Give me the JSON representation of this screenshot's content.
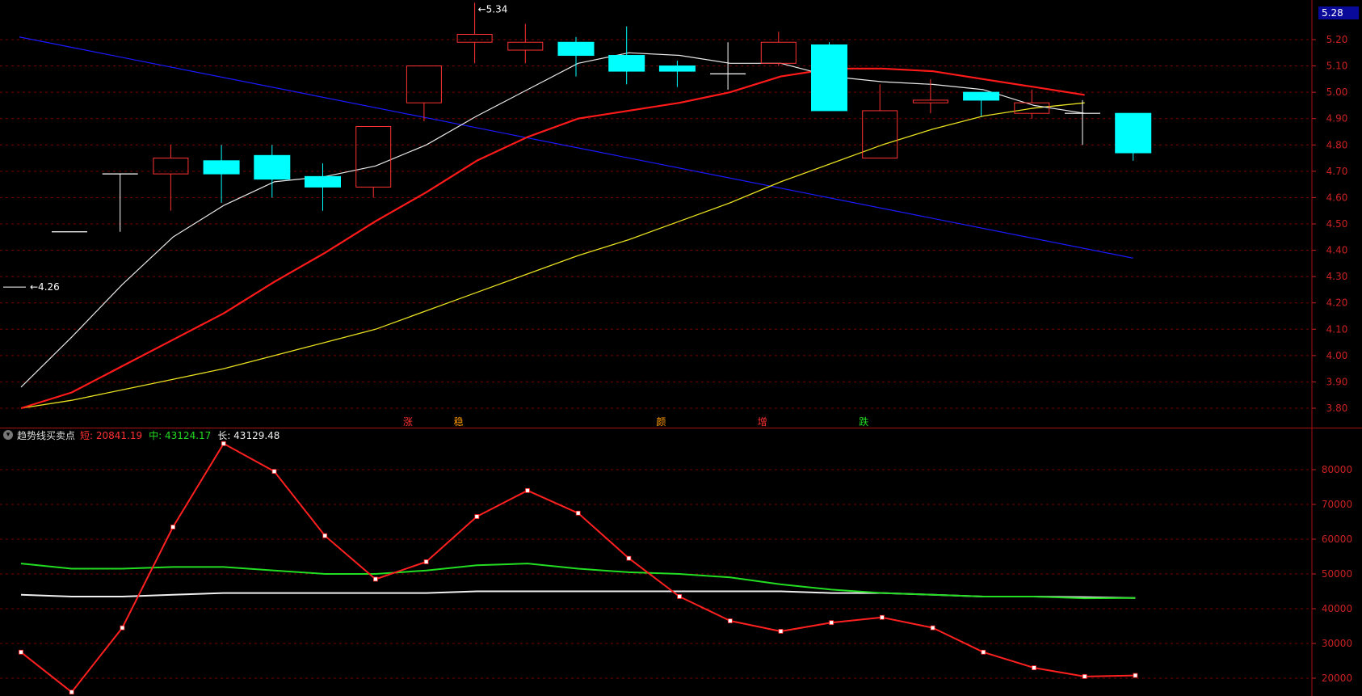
{
  "indicator": {
    "name": "趋势线买卖点",
    "short_label": "短",
    "mid_label": "中",
    "long_label": "长",
    "short_value": "20841.19",
    "mid_value": "43124.17",
    "long_value": "43129.48",
    "collapse_icon": "chevron-down-icon"
  },
  "current_price": "5.28",
  "colors": {
    "up": "#ff3333",
    "down": "#00ffff",
    "ma_white": "#e8e8e8",
    "ma_red": "#ff1a1a",
    "ma_yellow": "#e8e020",
    "trend_blue": "#1a1aff",
    "grid": "#7a0000",
    "axis_text": "#cc2222",
    "short_line": "#ff2020",
    "mid_line": "#22dd22",
    "long_line": "#f0f0f0"
  },
  "chart_data": [
    {
      "type": "candlestick",
      "ylim": [
        3.73,
        5.33
      ],
      "y_ticks": [
        "5.20",
        "5.10",
        "5.00",
        "4.90",
        "4.80",
        "4.70",
        "4.60",
        "4.50",
        "4.40",
        "4.30",
        "4.20",
        "4.10",
        "4.00",
        "3.90",
        "3.80"
      ],
      "candles": [
        {
          "open": 4.47,
          "close": 4.47,
          "high": 4.47,
          "low": 4.47
        },
        {
          "open": 4.69,
          "close": 4.69,
          "high": 4.69,
          "low": 4.47
        },
        {
          "open": 4.69,
          "close": 4.75,
          "high": 4.8,
          "low": 4.55
        },
        {
          "open": 4.74,
          "close": 4.69,
          "high": 4.8,
          "low": 4.58
        },
        {
          "open": 4.76,
          "close": 4.67,
          "high": 4.8,
          "low": 4.6
        },
        {
          "open": 4.68,
          "close": 4.64,
          "high": 4.73,
          "low": 4.55
        },
        {
          "open": 4.64,
          "close": 4.87,
          "high": 4.87,
          "low": 4.6
        },
        {
          "open": 4.96,
          "close": 5.1,
          "high": 5.1,
          "low": 4.89
        },
        {
          "open": 5.19,
          "close": 5.22,
          "high": 5.34,
          "low": 5.11
        },
        {
          "open": 5.16,
          "close": 5.19,
          "high": 5.26,
          "low": 5.11
        },
        {
          "open": 5.19,
          "close": 5.14,
          "high": 5.21,
          "low": 5.06
        },
        {
          "open": 5.14,
          "close": 5.08,
          "high": 5.25,
          "low": 5.03
        },
        {
          "open": 5.1,
          "close": 5.08,
          "high": 5.12,
          "low": 5.02
        },
        {
          "open": 5.07,
          "close": 5.07,
          "high": 5.19,
          "low": 5.01
        },
        {
          "open": 5.11,
          "close": 5.19,
          "high": 5.23,
          "low": 5.1
        },
        {
          "open": 5.18,
          "close": 4.93,
          "high": 5.19,
          "low": 4.93
        },
        {
          "open": 4.75,
          "close": 4.93,
          "high": 5.03,
          "low": 4.75
        },
        {
          "open": 4.96,
          "close": 4.97,
          "high": 5.05,
          "low": 4.92
        },
        {
          "open": 5.0,
          "close": 4.97,
          "high": 5.0,
          "low": 4.91
        },
        {
          "open": 4.92,
          "close": 4.96,
          "high": 5.01,
          "low": 4.9
        },
        {
          "open": 4.92,
          "close": 4.92,
          "high": 4.97,
          "low": 4.8
        },
        {
          "open": 4.92,
          "close": 4.77,
          "high": 4.92,
          "low": 4.74
        }
      ],
      "ma_white": [
        3.88,
        4.07,
        4.27,
        4.45,
        4.57,
        4.66,
        4.68,
        4.72,
        4.8,
        4.91,
        5.01,
        5.11,
        5.15,
        5.14,
        5.11,
        5.11,
        5.06,
        5.04,
        5.03,
        5.01,
        4.95,
        4.92
      ],
      "ma_red": [
        3.8,
        3.86,
        3.96,
        4.06,
        4.16,
        4.28,
        4.39,
        4.51,
        4.62,
        4.74,
        4.83,
        4.9,
        4.93,
        4.96,
        5.0,
        5.06,
        5.09,
        5.09,
        5.08,
        5.05,
        5.02,
        4.99
      ],
      "ma_yellow": [
        3.8,
        3.83,
        3.87,
        3.91,
        3.95,
        4.0,
        4.05,
        4.1,
        4.17,
        4.24,
        4.31,
        4.38,
        4.44,
        4.51,
        4.58,
        4.66,
        4.73,
        4.8,
        4.86,
        4.91,
        4.94,
        4.96
      ],
      "trend_line": {
        "start": 5.21,
        "end": 4.37
      },
      "annotations": [
        {
          "text": "5.34",
          "index": 8,
          "value": 5.34
        },
        {
          "text": "4.26",
          "index": 0,
          "value": 4.26
        }
      ],
      "markers": [
        {
          "text": "涨",
          "index": 7,
          "color": "#ff3030"
        },
        {
          "text": "稳",
          "index": 8,
          "color": "#ff9900"
        },
        {
          "text": "颜",
          "index": 12,
          "color": "#ff9900"
        },
        {
          "text": "增",
          "index": 14,
          "color": "#ff3030"
        },
        {
          "text": "跌",
          "index": 16,
          "color": "#22dd22"
        }
      ]
    },
    {
      "type": "line",
      "ylim": [
        15000,
        90000
      ],
      "y_ticks": [
        "80000",
        "70000",
        "60000",
        "50000",
        "40000",
        "30000",
        "20000"
      ],
      "series": [
        {
          "name": "短",
          "values": [
            27500,
            16000,
            34500,
            63500,
            87500,
            79500,
            61000,
            48500,
            53500,
            66500,
            74000,
            67500,
            54500,
            43500,
            36500,
            33500,
            36000,
            37500,
            34500,
            27500,
            23000,
            20500,
            20800
          ]
        },
        {
          "name": "中",
          "values": [
            53000,
            51500,
            51500,
            52000,
            52000,
            51000,
            50000,
            50000,
            51000,
            52500,
            53000,
            51500,
            50500,
            50000,
            49000,
            47000,
            45500,
            44500,
            44000,
            43500,
            43500,
            43000,
            43100
          ]
        },
        {
          "name": "长",
          "values": [
            44000,
            43500,
            43500,
            44000,
            44500,
            44500,
            44500,
            44500,
            44500,
            45000,
            45000,
            45000,
            45000,
            45000,
            45000,
            45000,
            44500,
            44500,
            44000,
            43500,
            43500,
            43300,
            43100
          ]
        }
      ]
    }
  ]
}
